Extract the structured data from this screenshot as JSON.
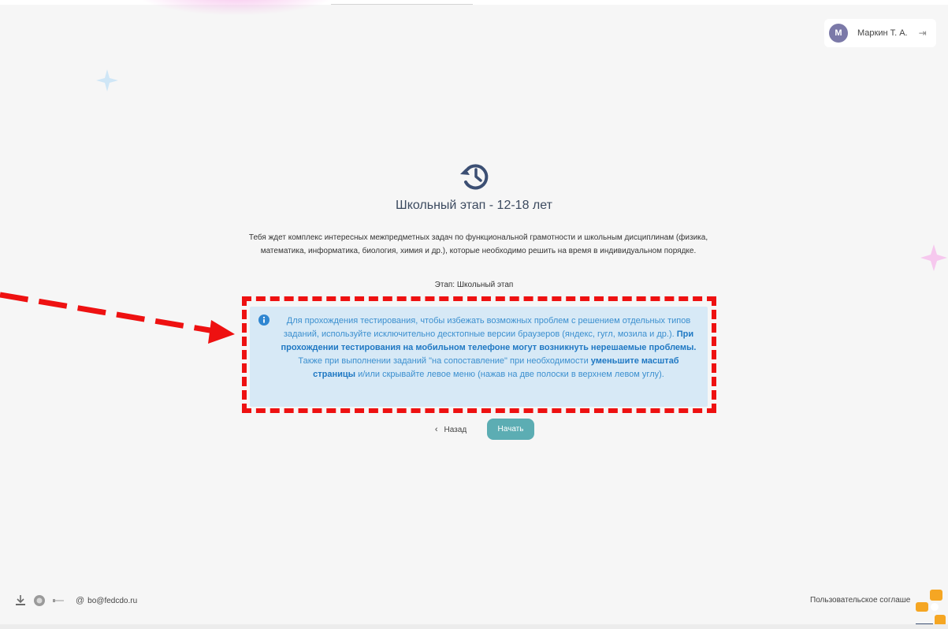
{
  "user": {
    "initial": "М",
    "name": "Маркин Т. А.",
    "logout_icon": "logout-icon"
  },
  "stage": {
    "icon": "history-icon",
    "title": "Школьный этап - 12-18 лет",
    "description": "Тебя ждет комплекс интересных межпредметных задач по функциональной грамотности и школьным дисциплинам (физика, математика, информатика, биология, химия и др.), которые необходимо решить на время в индивидуальном порядке.",
    "stage_line": "Этап: Школьный этап"
  },
  "notice": {
    "icon": "info-icon",
    "text_1": "Для прохождения тестирования, чтобы избежать возможных проблем с решением отдельных типов заданий, используйте исключительно десктопные версии браузеров (яндекс, гугл, мозила и др.).",
    "bold_1": "При прохождении тестирования на мобильном телефоне могут возникнуть нерешаемые проблемы.",
    "text_2": "Также при выполнении заданий \"на сопоставление\" при необходимости",
    "bold_2": "уменьшите масштаб страницы",
    "text_3": "и/или скрывайте левое меню (нажав на две полоски в верхнем левом углу)."
  },
  "actions": {
    "back_label": "Назад",
    "start_label": "Начать"
  },
  "footer": {
    "email": "bo@fedcdo.ru",
    "agreement": "Пользовательское соглаше"
  },
  "colors": {
    "accent_button": "#5cadb3",
    "info_bg": "#d7e9f6",
    "info_text": "#3b8fcf",
    "annotation_red": "#ee1111",
    "avatar": "#7b79a8"
  }
}
